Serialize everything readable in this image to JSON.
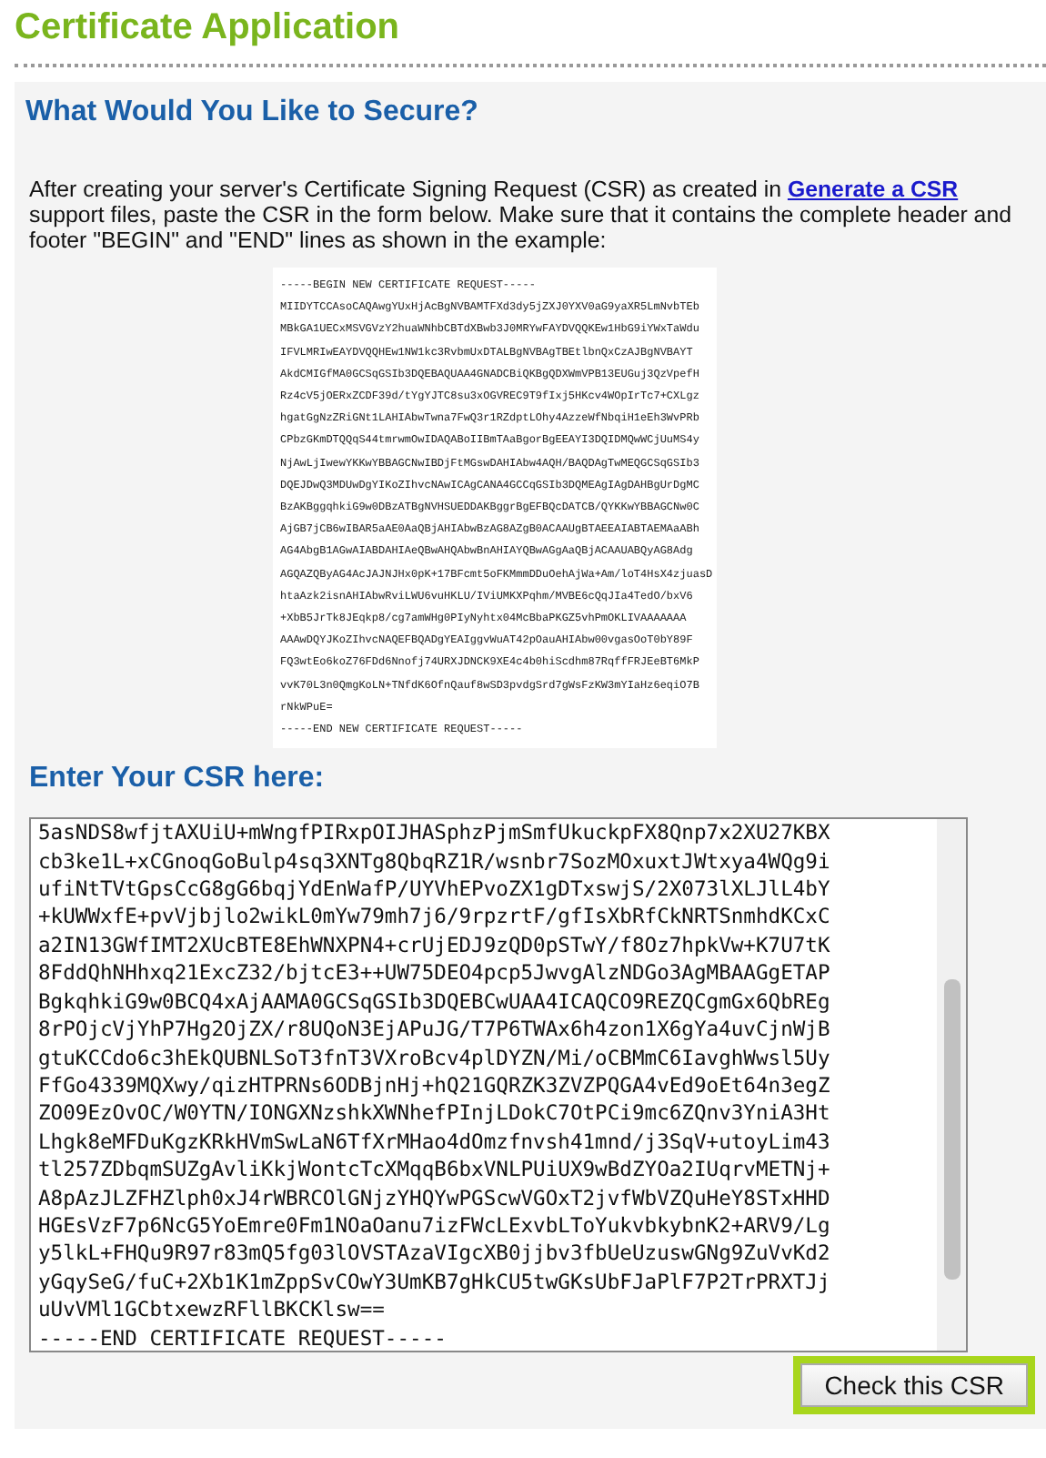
{
  "page_title": "Certificate Application",
  "section_title": "What Would You Like to Secure?",
  "intro": {
    "before": "After creating your server's Certificate Signing Request (CSR) as created in ",
    "link": "Generate a CSR",
    "after": " support files, paste the CSR in the form below. Make sure that it contains the complete header and footer \"BEGIN\" and \"END\" lines as shown in the example:"
  },
  "example_csr": [
    "-----BEGIN NEW CERTIFICATE REQUEST-----",
    "MIIDYTCCAsoCAQAwgYUxHjAcBgNVBAMTFXd3dy5jZXJ0YXV0aG9yaXR5LmNvbTEb",
    "MBkGA1UECxMSVGVzY2huaWNhbCBTdXBwb3J0MRYwFAYDVQQKEw1HbG9iYWxTaWdu",
    "IFVLMRIwEAYDVQQHEw1NW1kc3RvbmUxDTALBgNVBAgTBEtlbnQxCzAJBgNVBAYT",
    "AkdCMIGfMA0GCSqGSIb3DQEBAQUAA4GNADCBiQKBgQDXWmVPB13EUGuj3QzVpefH",
    "Rz4cV5jOERxZCDF39d/tYgYJTC8su3xOGVREC9T9fIxj5HKcv4WOpIrTc7+CXLgz",
    "hgatGgNzZRiGNt1LAHIAbwTwna7FwQ3r1RZdptLOhy4AzzeWfNbqiH1eEh3WvPRb",
    "CPbzGKmDTQQqS44tmrwmOwIDAQABoIIBmTAaBgorBgEEAYI3DQIDMQwWCjUuMS4y",
    "NjAwLjIwewYKKwYBBAGCNwIBDjFtMGswDAHIAbw4AQH/BAQDAgTwMEQGCSqGSIb3",
    "DQEJDwQ3MDUwDgYIKoZIhvcNAwICAgCANA4GCCqGSIb3DQMEAgIAgDAHBgUrDgMC",
    "BzAKBggqhkiG9w0DBzATBgNVHSUEDDAKBggrBgEFBQcDATCB/QYKKwYBBAGCNw0C",
    "AjGB7jCB6wIBAR5aAE0AaQBjAHIAbwBzAG8AZgB0ACAAUgBTAEEAIABTAEMAaABh",
    "AG4AbgB1AGwAIABDAHIAeQBwAHQAbwBnAHIAYQBwAGgAaQBjACAAUABQyAG8Adg",
    "AGQAZQByAG4AcJAJNJHx0pK+17BFcmt5oFKMmmDDuOehAjWa+Am/loT4HsX4zjuasD",
    "htaAzk2isnAHIAbwRviLWU6vuHKLU/IViUMKXPqhm/MVBE6cQqJIa4TedO/bxV6",
    "+XbB5JrTk8JEqkp8/cg7amWHg0PIyNyhtx04McBbaPKGZ5vhPmOKLIVAAAAAAA",
    "AAAwDQYJKoZIhvcNAQEFBQADgYEAIggvWuAT42pOauAHIAbw00vgasOoT0bY89F",
    "FQ3wtEo6koZ76FDd6Nnofj74URXJDNCK9XE4c4b0hiScdhm87RqffFRJEeBT6MkP",
    "vvK70L3n0QmgKoLN+TNfdK6OfnQauf8wSD3pvdgSrd7gWsFzKW3mYIaHz6eqiO7B",
    "rNkWPuE=",
    "-----END NEW CERTIFICATE REQUEST-----"
  ],
  "csr_heading": "Enter Your CSR here:",
  "csr_field": {
    "value": [
      "5asNDS8wfjtAXUiU+mWngfPIRxpOIJHASphzPjmSmfUkuckpFX8Qnp7x2XU27KBX",
      "cb3ke1L+xCGnoqGoBulp4sq3XNTg8QbqRZ1R/wsnbr7SozMOxuxtJWtxya4WQg9i",
      "ufiNtTVtGpsCcG8gG6bqjYdEnWafP/UYVhEPvoZX1gDTxswjS/2X073lXLJlL4bY",
      "+kUWWxfE+pvVjbjlo2wikL0mYw79mh7j6/9rpzrtF/gfIsXbRfCkNRTSnmhdKCxC",
      "a2IN13GWfIMT2XUcBTE8EhWNXPN4+crUjEDJ9zQD0pSTwY/f8Oz7hpkVw+K7U7tK",
      "8FddQhNHhxq21ExcZ32/bjtcE3++UW75DEO4pcp5JwvgAlzNDGo3AgMBAAGgETAP",
      "BgkqhkiG9w0BCQ4xAjAAMA0GCSqGSIb3DQEBCwUAA4ICAQCO9REZQCgmGx6QbREg",
      "8rPOjcVjYhP7Hg2OjZX/r8UQoN3EjAPuJG/T7P6TWAx6h4zon1X6gYa4uvCjnWjB",
      "gtuKCCdo6c3hEkQUBNLSoT3fnT3VXroBcv4plDYZN/Mi/oCBMmC6IavghWwsl5Uy",
      "FfGo4339MQXwy/qizHTPRNs6ODBjnHj+hQ21GQRZK3ZVZPQGA4vEd9oEt64n3egZ",
      "ZO09EzOvOC/W0YTN/IONGXNzshkXWNhefPInjLDokC7OtPCi9mc6ZQnv3YniA3Ht",
      "Lhgk8eMFDuKgzKRkHVmSwLaN6TfXrMHao4dOmzfnvsh41mnd/j3SqV+utoyLim43",
      "tl257ZDbqmSUZgAvliKkjWontcTcXMqqB6bxVNLPUiUX9wBdZYOa2IUqrvMETNj+",
      "A8pAzJLZFHZlph0xJ4rWBRCOlGNjzYHQYwPGScwVGOxT2jvfWbVZQuHeY8STxHHD",
      "HGEsVzF7p6NcG5YoEmre0Fm1NOaOanu7izFWcLExvbLToYukvbkybnK2+ARV9/Lg",
      "y5lkL+FHQu9R97r83mQ5fg03lOVSTAzaVIgcXB0jjbv3fbUeUzuswGNg9ZuVvKd2",
      "yGqySeG/fuC+2Xb1K1mZppSvCOwY3UmKB7gHkCU5twGKsUbFJaPlF7P2TrPRXTJj",
      "uUvVMl1GCbtxewzRFllBKCKlsw==",
      "-----END CERTIFICATE REQUEST-----"
    ]
  },
  "submit_button": "Check this CSR"
}
